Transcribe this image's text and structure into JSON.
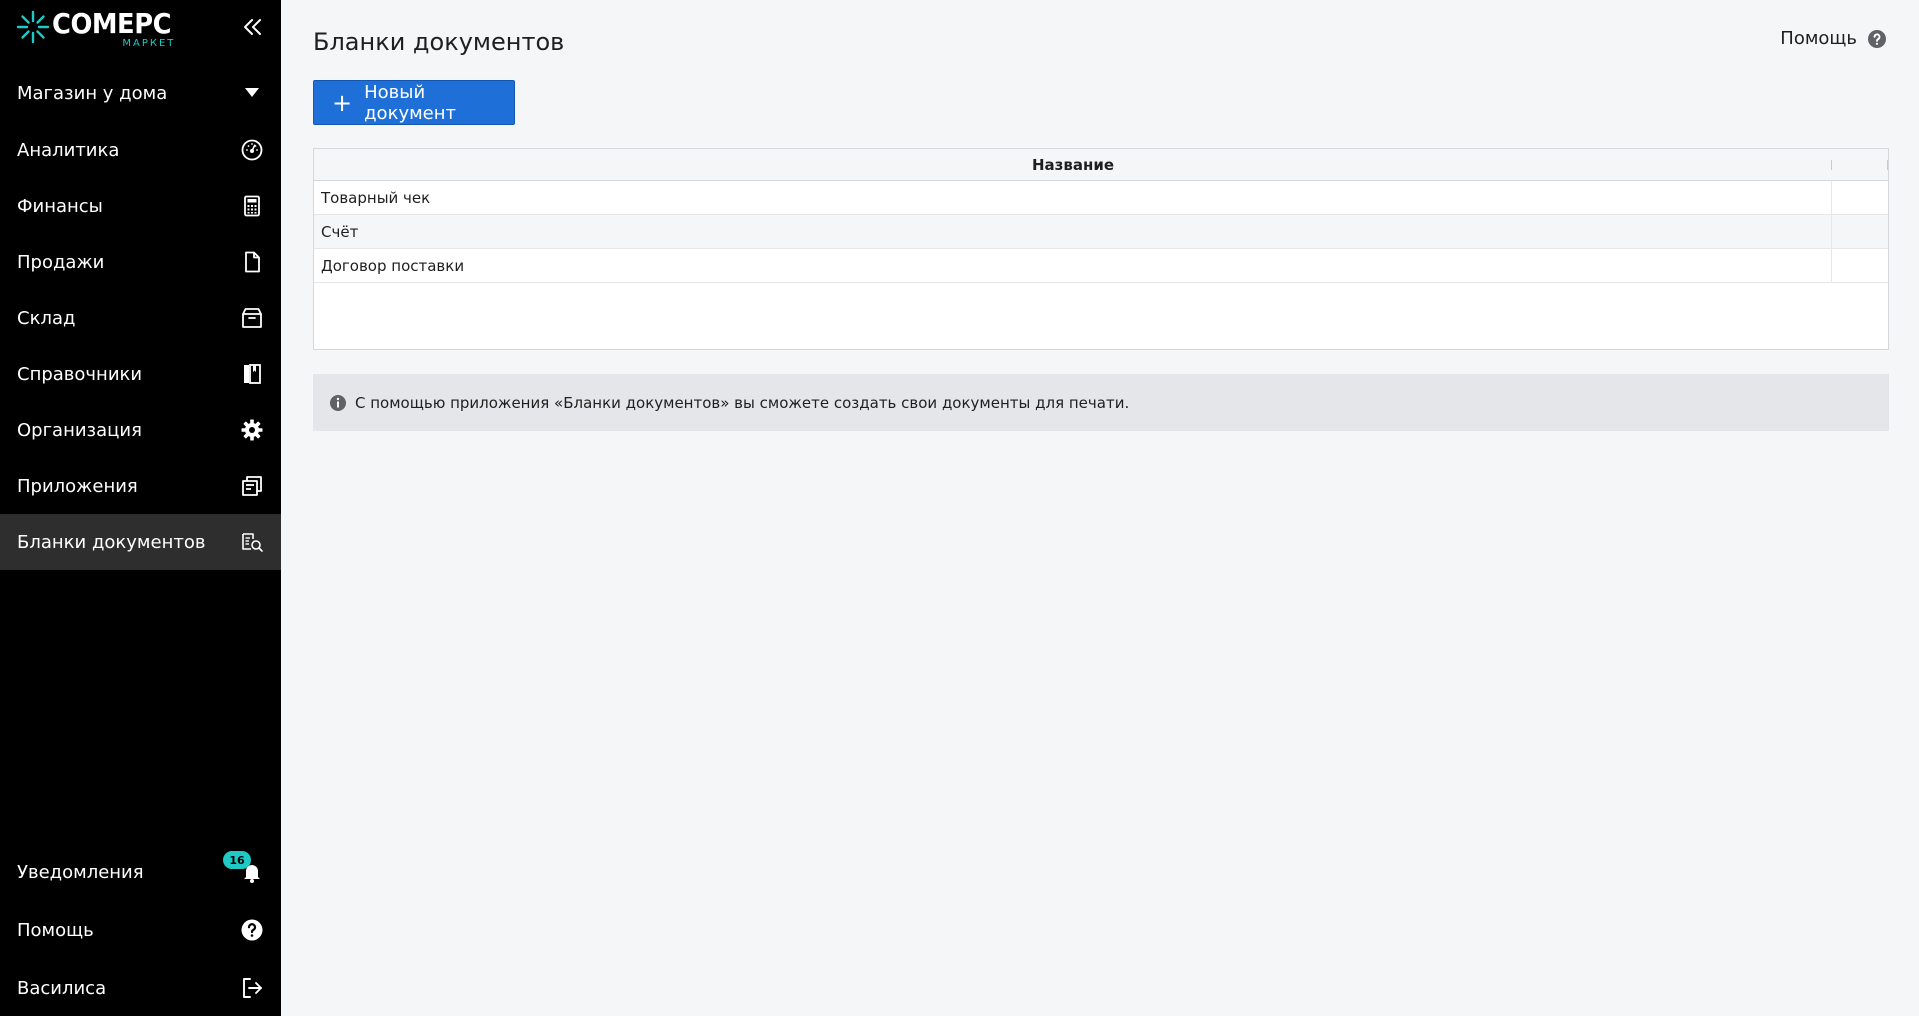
{
  "brand": {
    "name": "COMEPC",
    "sub": "МАРКЕТ",
    "accent": "#1fc9c5"
  },
  "sidebar": {
    "store": "Магазин у дома",
    "items": [
      {
        "label": "Аналитика",
        "icon": "speedometer-icon"
      },
      {
        "label": "Финансы",
        "icon": "calculator-icon"
      },
      {
        "label": "Продажи",
        "icon": "document-icon"
      },
      {
        "label": "Склад",
        "icon": "box-icon"
      },
      {
        "label": "Справочники",
        "icon": "books-icon"
      },
      {
        "label": "Организация",
        "icon": "gear-icon"
      },
      {
        "label": "Приложения",
        "icon": "apps-icon"
      },
      {
        "label": "Бланки документов",
        "icon": "document-search-icon",
        "active": true
      }
    ],
    "notifications": {
      "label": "Уведомления",
      "count": "16"
    },
    "help": "Помощь",
    "user": "Василиса"
  },
  "main": {
    "title": "Бланки документов",
    "help_link": "Помощь",
    "new_button": "Новый документ",
    "table": {
      "header": "Название",
      "rows": [
        "Товарный чек",
        "Счёт",
        "Договор поставки"
      ]
    },
    "info": "С помощью приложения «Бланки документов» вы сможете создать свои документы для печати."
  }
}
